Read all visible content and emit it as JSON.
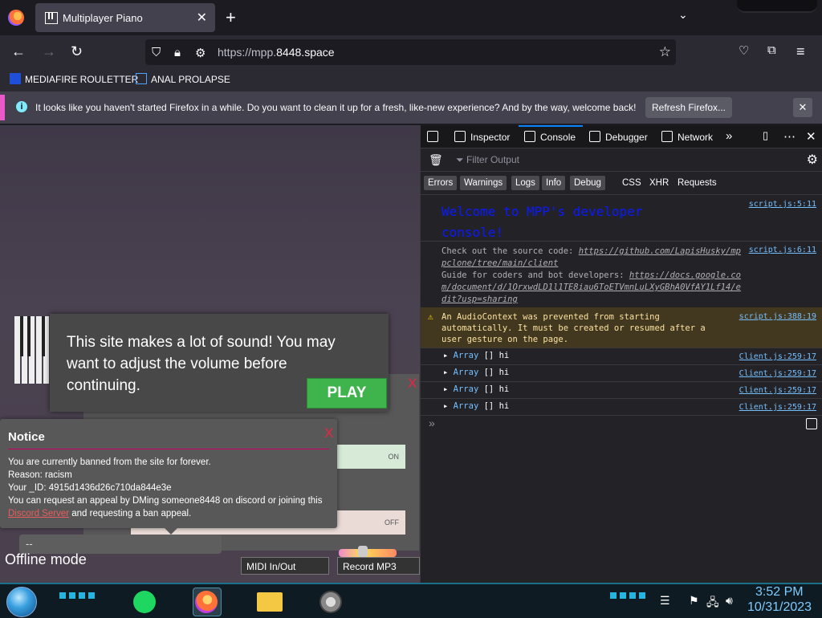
{
  "tab": {
    "title": "Multiplayer Piano",
    "close": "✕",
    "new_tab": "+",
    "list_tabs": "⌄"
  },
  "nav": {
    "back": "←",
    "forward": "→",
    "reload": "↻",
    "url_prefix": "https://mpp.",
    "url_domain": "8448.space"
  },
  "bookmarks": [
    {
      "label": "MEDIAFIRE ROULETTER",
      "icon": "mediafire-icon"
    },
    {
      "label": "ANAL PROLAPSE",
      "icon": "bookmark-icon"
    }
  ],
  "notification": {
    "text": "It looks like you haven't started Firefox in a while. Do you want to clean it up for a fresh, like-new experience? And by the way, welcome back!",
    "button": "Refresh Firefox...",
    "close": "✕"
  },
  "page": {
    "modal_text": "This site makes a lot of sound! You may want to adjust the volume before continuing.",
    "play_label": "PLAY",
    "bg_close": "X",
    "on_label": "ON",
    "off_label": "OFF",
    "notice": {
      "title": "Notice",
      "close": "X",
      "line1": "You are currently banned from the site for forever.",
      "line2": "Reason: racism",
      "line3": "Your _ID: 4915d1436d26c710da844e3e",
      "line4_a": "You can request an appeal by DMing someone8448 on discord or joining this ",
      "link": "Discord Server",
      "line4_b": " and requesting a ban appeal."
    },
    "chat_placeholder": "--",
    "offline": "Offline mode",
    "midi": "MIDI In/Out",
    "record": "Record MP3"
  },
  "devtools": {
    "tabs": [
      "Inspector",
      "Console",
      "Debugger",
      "Network"
    ],
    "more": "»",
    "filter_placeholder": "Filter Output",
    "categories": [
      "Errors",
      "Warnings",
      "Logs",
      "Info",
      "Debug",
      "CSS",
      "XHR",
      "Requests"
    ],
    "welcome": "Welcome to MPP's developer console!",
    "welcome_src": "script.js:5:11",
    "info_line1": "Check out the source code: ",
    "info_link1": "https://github.com/LapisHusky/mppclone/tree/main/client",
    "info_line2": "Guide for coders and bot developers: ",
    "info_link2": "https://docs.google.com/document/d/1OrxwdLD1l1TE8iau6ToETVmnLuLXyGBhA0VfAY1Lf14/edit?usp=sharing",
    "info_src": "script.js:6:11",
    "warning": "An AudioContext was prevented from starting automatically. It must be created or resumed after a user gesture on the page.",
    "warning_src": "script.js:388:19",
    "array_rows": [
      {
        "type": "Array",
        "val": "[]",
        "text": "hi",
        "src": "Client.js:259:17"
      },
      {
        "type": "Array",
        "val": "[]",
        "text": "hi",
        "src": "Client.js:259:17"
      },
      {
        "type": "Array",
        "val": "[]",
        "text": "hi",
        "src": "Client.js:259:17"
      },
      {
        "type": "Array",
        "val": "[]",
        "text": "hi",
        "src": "Client.js:259:17"
      }
    ],
    "prompt": "»"
  },
  "taskbar": {
    "time": "3:52 PM",
    "date": "10/31/2023"
  }
}
